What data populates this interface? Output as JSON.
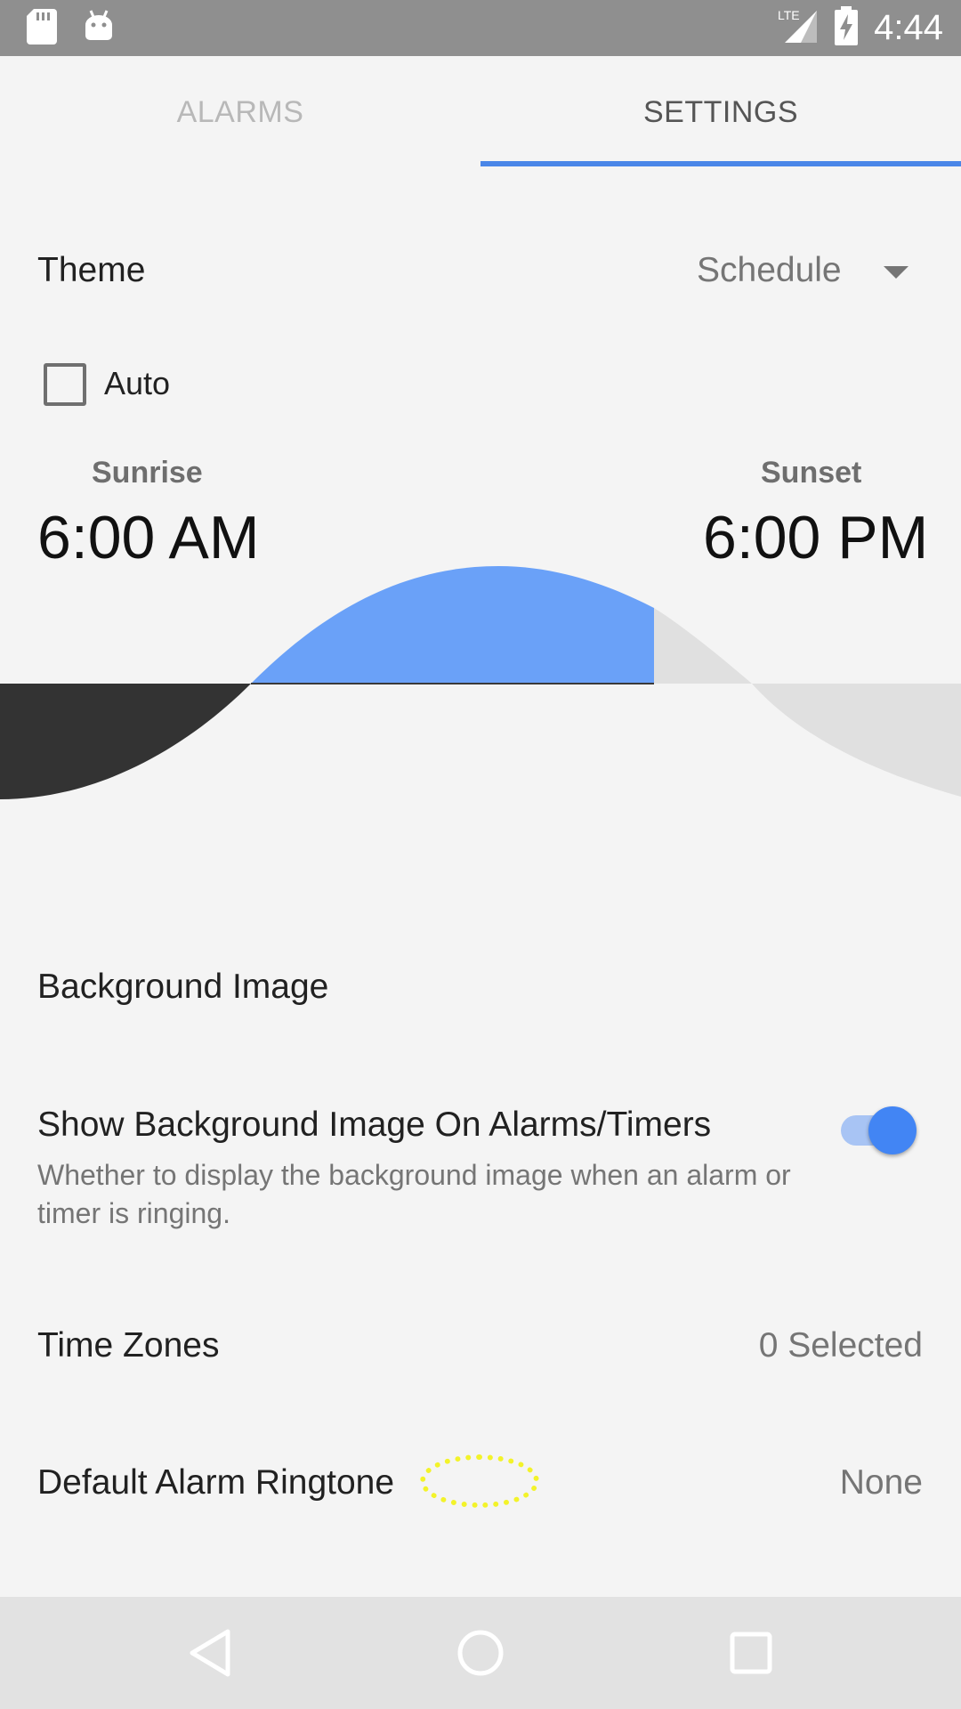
{
  "status_bar": {
    "time": "4:44",
    "network": "LTE",
    "icons": [
      "sd-card-icon",
      "android-icon",
      "lte-signal-icon",
      "battery-charging-icon"
    ]
  },
  "tabs": [
    {
      "label": "ALARMS",
      "selected": false
    },
    {
      "label": "SETTINGS",
      "selected": true
    }
  ],
  "accent_color": "#4a86e8",
  "theme": {
    "label": "Theme",
    "value": "Schedule"
  },
  "auto": {
    "label": "Auto",
    "checked": false
  },
  "schedule": {
    "sunrise_label": "Sunrise",
    "sunrise_time": "6:00 AM",
    "sunset_label": "Sunset",
    "sunset_time": "6:00 PM",
    "day_color": "#6aa1f8",
    "night_color": "#333333"
  },
  "background_image": {
    "label": "Background Image"
  },
  "show_background": {
    "label": "Show Background Image On Alarms/Timers",
    "description": "Whether to display the background image when an alarm or timer is ringing.",
    "enabled": true
  },
  "time_zones": {
    "label": "Time Zones",
    "value": "0 Selected"
  },
  "default_ringtone": {
    "label": "Default Alarm Ringtone",
    "value": "None"
  },
  "nav_bar": {
    "buttons": [
      "back-icon",
      "home-icon",
      "recents-icon"
    ]
  }
}
